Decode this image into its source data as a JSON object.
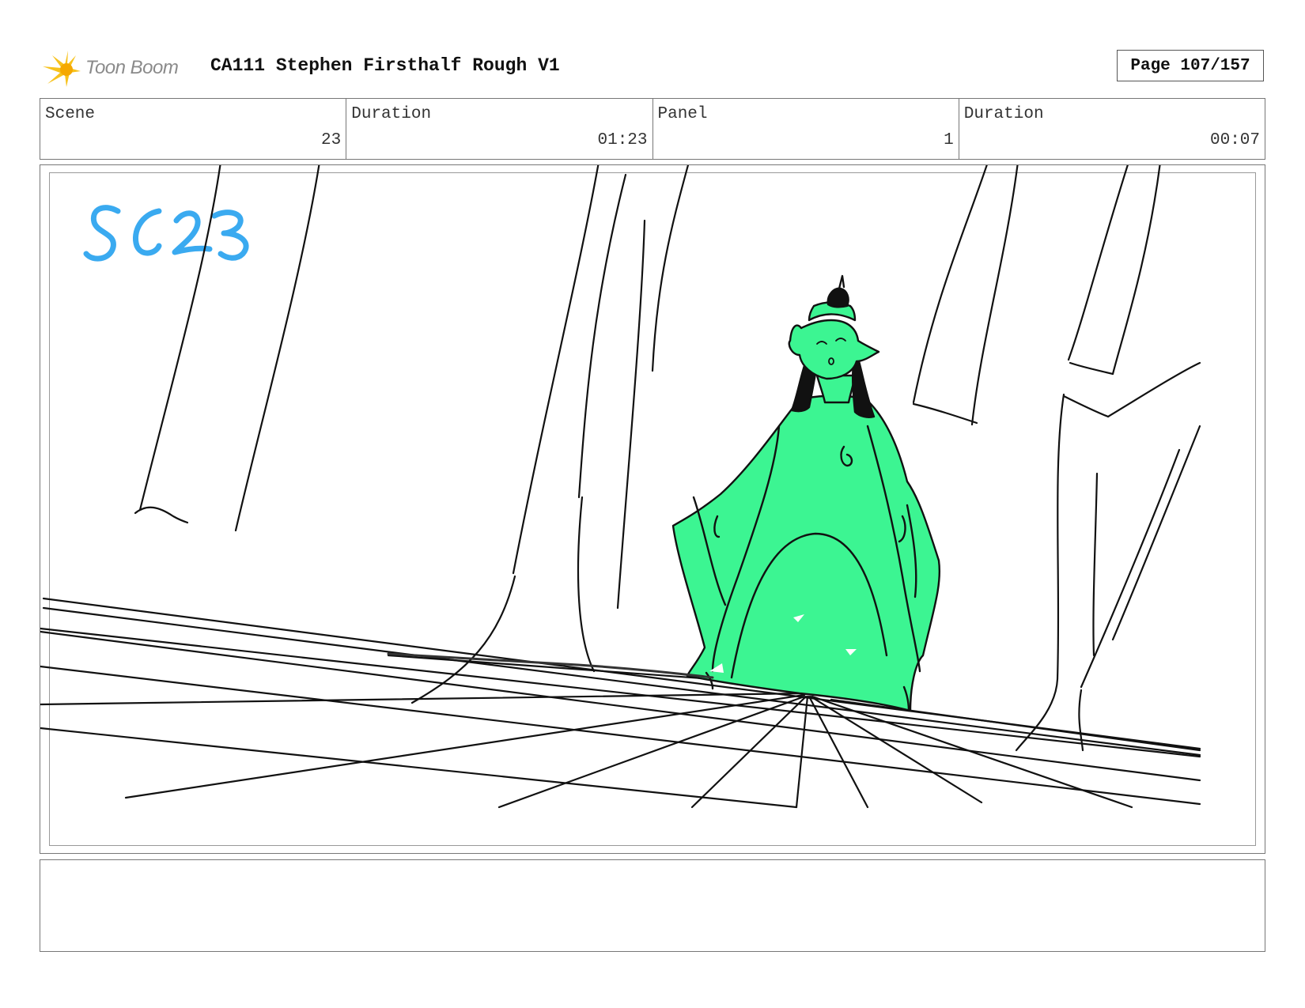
{
  "header": {
    "logo_text": "Toon Boom",
    "title": "CA111 Stephen Firsthalf Rough V1",
    "page": "Page 107/157"
  },
  "info": {
    "scene_label": "Scene",
    "scene_value": "23",
    "scene_duration_label": "Duration",
    "scene_duration_value": "01:23",
    "panel_label": "Panel",
    "panel_value": "1",
    "panel_duration_label": "Duration",
    "panel_duration_value": "00:07"
  },
  "panel": {
    "annotation": "SC23",
    "annotation_color": "#3aaaf0",
    "figure_fill": "#3cf592",
    "line_color": "#111111"
  },
  "notes": {
    "text": ""
  }
}
